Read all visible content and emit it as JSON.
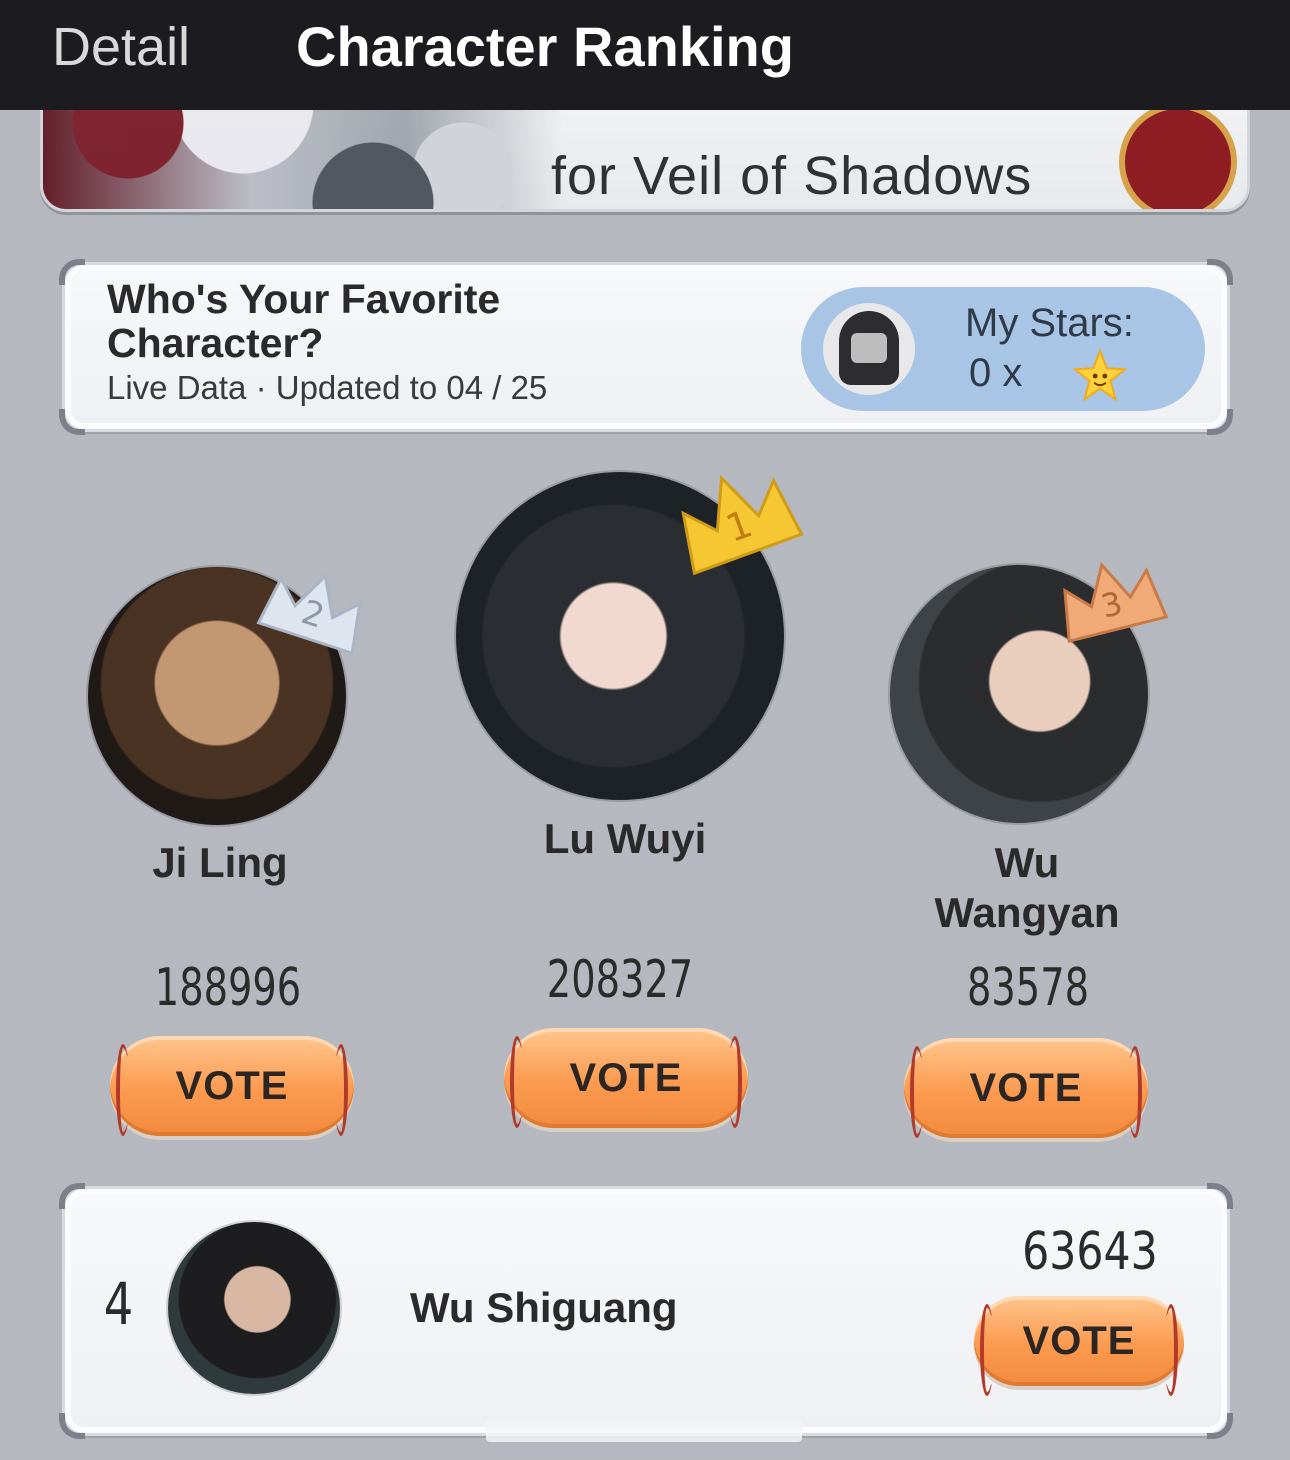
{
  "topbar": {
    "tabs": [
      {
        "label": "Detail",
        "active": false
      },
      {
        "label": "Character Ranking",
        "active": true
      }
    ]
  },
  "banner": {
    "title_fragment": "for Veil of Shadows"
  },
  "header": {
    "title": "Who's Your Favorite Character?",
    "subtitle": "Live Data · Updated to 04 / 25",
    "stars_label": "My Stars:",
    "stars_count": "0 x",
    "star_icon": "star-icon"
  },
  "vote_label": "VOTE",
  "podium": [
    {
      "rank": "2",
      "name": "Ji Ling",
      "votes": "188996",
      "crown_color": "#cfd6e2"
    },
    {
      "rank": "1",
      "name": "Lu Wuyi",
      "votes": "208327",
      "crown_color": "#f2c12e"
    },
    {
      "rank": "3",
      "name": "Wu Wangyan",
      "votes": "83578",
      "crown_color": "#e9a06b"
    }
  ],
  "list": [
    {
      "rank": "4",
      "name": "Wu Shiguang",
      "votes": "63643"
    }
  ],
  "colors": {
    "background": "#b5b8bf",
    "topbar": "#1c1b1f",
    "stars_pill": "#a9c5e6",
    "vote_button": "#fb9a4f"
  }
}
